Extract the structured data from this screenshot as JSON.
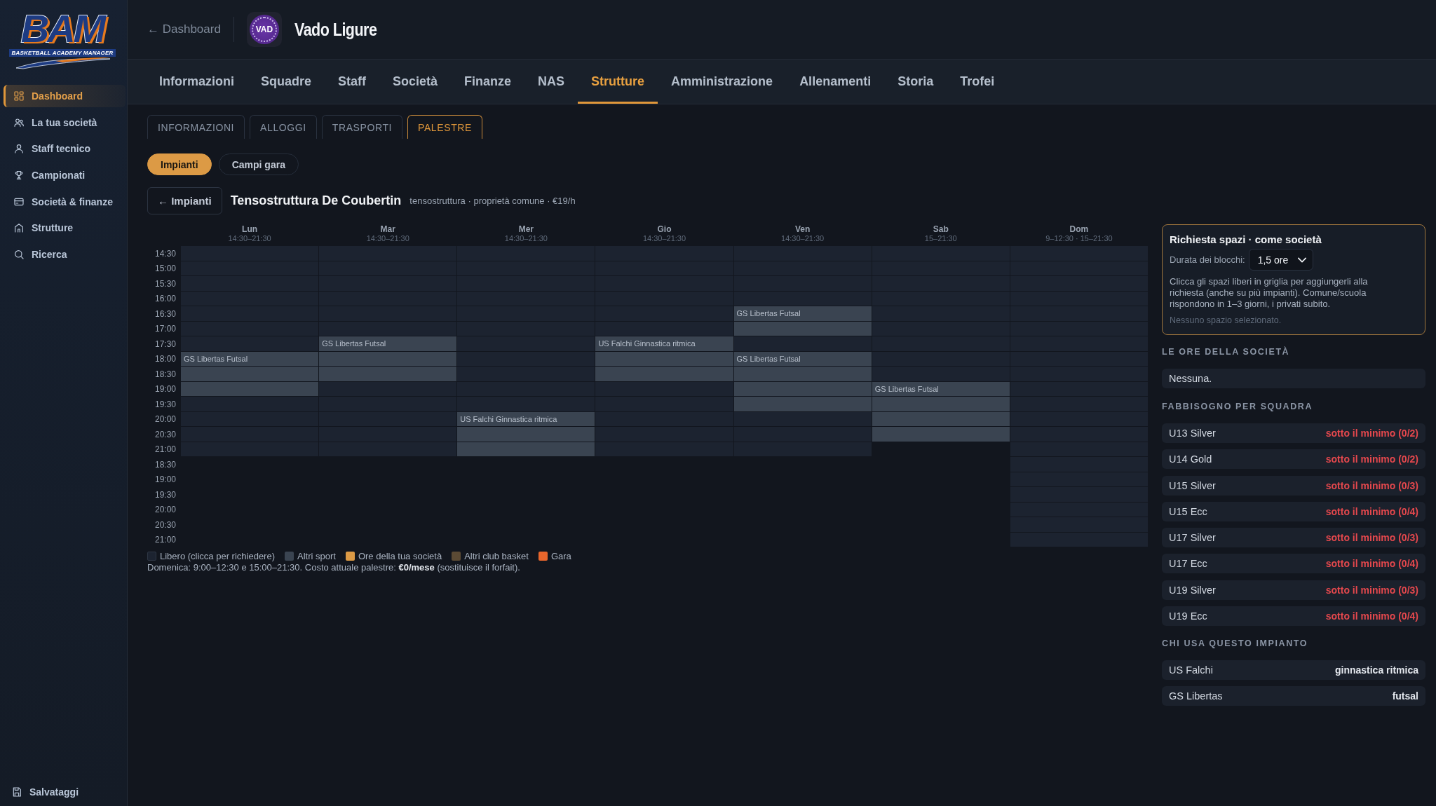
{
  "sidebar": {
    "logo": {
      "wordmark": "BAM",
      "tagline": "BASKETBALL ACADEMY MANAGER"
    },
    "items": [
      {
        "label": "Dashboard",
        "selected": true
      },
      {
        "label": "La tua società",
        "selected": false
      },
      {
        "label": "Staff tecnico",
        "selected": false
      },
      {
        "label": "Campionati",
        "selected": false
      },
      {
        "label": "Società & finanze",
        "selected": false
      },
      {
        "label": "Strutture",
        "selected": false
      },
      {
        "label": "Ricerca",
        "selected": false
      }
    ],
    "footer_item": "Salvataggi"
  },
  "header": {
    "back_link": "← Dashboard",
    "club": {
      "badge": "VAD",
      "name": "Vado Ligure"
    }
  },
  "main_tabs": [
    {
      "label": "Informazioni",
      "selected": false
    },
    {
      "label": "Squadre",
      "selected": false
    },
    {
      "label": "Staff",
      "selected": false
    },
    {
      "label": "Società",
      "selected": false
    },
    {
      "label": "Finanze",
      "selected": false
    },
    {
      "label": "NAS",
      "selected": false
    },
    {
      "label": "Strutture",
      "selected": true
    },
    {
      "label": "Amministrazione",
      "selected": false
    },
    {
      "label": "Allenamenti",
      "selected": false
    },
    {
      "label": "Storia",
      "selected": false
    },
    {
      "label": "Trofei",
      "selected": false
    }
  ],
  "sub_tabs": [
    {
      "label": "INFORMAZIONI",
      "selected": false
    },
    {
      "label": "ALLOGGI",
      "selected": false
    },
    {
      "label": "TRASPORTI",
      "selected": false
    },
    {
      "label": "PALESTRE",
      "selected": true
    }
  ],
  "view_tabs": [
    {
      "label": "Impianti",
      "selected": true
    },
    {
      "label": "Campi gara",
      "selected": false
    }
  ],
  "facility": {
    "back_button": "← Impianti",
    "title": "Tensostruttura De Coubertin",
    "details": "tensostruttura · proprietà comune · €19/h"
  },
  "schedule": {
    "times": [
      "14:30",
      "15:00",
      "15:30",
      "16:00",
      "16:30",
      "17:00",
      "17:30",
      "18:00",
      "18:30",
      "19:00",
      "19:30",
      "20:00",
      "20:30",
      "21:00",
      "18:30",
      "19:00",
      "19:30",
      "20:00",
      "20:30",
      "21:00"
    ],
    "days": [
      {
        "name": "Lun",
        "hours": "14:30–21:30",
        "slots": [
          {
            "kind": "free"
          },
          {
            "kind": "free"
          },
          {
            "kind": "free"
          },
          {
            "kind": "free"
          },
          {
            "kind": "free"
          },
          {
            "kind": "free"
          },
          {
            "kind": "free"
          },
          {
            "kind": "other_sport",
            "label": "GS Libertas Futsal"
          },
          {
            "kind": "other_sport"
          },
          {
            "kind": "other_sport"
          },
          {
            "kind": "free"
          },
          {
            "kind": "free"
          },
          {
            "kind": "free"
          },
          {
            "kind": "free"
          }
        ]
      },
      {
        "name": "Mar",
        "hours": "14:30–21:30",
        "slots": [
          {
            "kind": "free"
          },
          {
            "kind": "free"
          },
          {
            "kind": "free"
          },
          {
            "kind": "free"
          },
          {
            "kind": "free"
          },
          {
            "kind": "free"
          },
          {
            "kind": "other_sport",
            "label": "GS Libertas Futsal"
          },
          {
            "kind": "other_sport"
          },
          {
            "kind": "other_sport"
          },
          {
            "kind": "free"
          },
          {
            "kind": "free"
          },
          {
            "kind": "free"
          },
          {
            "kind": "free"
          },
          {
            "kind": "free"
          }
        ]
      },
      {
        "name": "Mer",
        "hours": "14:30–21:30",
        "slots": [
          {
            "kind": "free"
          },
          {
            "kind": "free"
          },
          {
            "kind": "free"
          },
          {
            "kind": "free"
          },
          {
            "kind": "free"
          },
          {
            "kind": "free"
          },
          {
            "kind": "free"
          },
          {
            "kind": "free"
          },
          {
            "kind": "free"
          },
          {
            "kind": "free"
          },
          {
            "kind": "free"
          },
          {
            "kind": "other_sport",
            "label": "US Falchi Ginnastica ritmica"
          },
          {
            "kind": "other_sport"
          },
          {
            "kind": "other_sport"
          }
        ]
      },
      {
        "name": "Gio",
        "hours": "14:30–21:30",
        "slots": [
          {
            "kind": "free"
          },
          {
            "kind": "free"
          },
          {
            "kind": "free"
          },
          {
            "kind": "free"
          },
          {
            "kind": "free"
          },
          {
            "kind": "free"
          },
          {
            "kind": "other_sport",
            "label": "US Falchi Ginnastica ritmica"
          },
          {
            "kind": "other_sport"
          },
          {
            "kind": "other_sport"
          },
          {
            "kind": "free"
          },
          {
            "kind": "free"
          },
          {
            "kind": "free"
          },
          {
            "kind": "free"
          },
          {
            "kind": "free"
          }
        ]
      },
      {
        "name": "Ven",
        "hours": "14:30–21:30",
        "slots": [
          {
            "kind": "free"
          },
          {
            "kind": "free"
          },
          {
            "kind": "free"
          },
          {
            "kind": "free"
          },
          {
            "kind": "other_sport",
            "label": "GS Libertas Futsal"
          },
          {
            "kind": "other_sport"
          },
          {
            "kind": "free"
          },
          {
            "kind": "other_sport",
            "label": "GS Libertas Futsal"
          },
          {
            "kind": "other_sport"
          },
          {
            "kind": "other_sport"
          },
          {
            "kind": "other_sport"
          },
          {
            "kind": "free"
          },
          {
            "kind": "free"
          },
          {
            "kind": "free"
          }
        ]
      },
      {
        "name": "Sab",
        "hours": "15–21:30",
        "slots": [
          {
            "kind": "free"
          },
          {
            "kind": "free"
          },
          {
            "kind": "free"
          },
          {
            "kind": "free"
          },
          {
            "kind": "free"
          },
          {
            "kind": "free"
          },
          {
            "kind": "free"
          },
          {
            "kind": "free"
          },
          {
            "kind": "free"
          },
          {
            "kind": "other_sport",
            "label": "GS Libertas Futsal"
          },
          {
            "kind": "other_sport"
          },
          {
            "kind": "other_sport"
          },
          {
            "kind": "other_sport"
          }
        ]
      },
      {
        "name": "Dom",
        "hours": "9–12:30 · 15–21:30",
        "slots": [
          {
            "kind": "free"
          },
          {
            "kind": "free"
          },
          {
            "kind": "free"
          },
          {
            "kind": "free"
          },
          {
            "kind": "free"
          },
          {
            "kind": "free"
          },
          {
            "kind": "free"
          },
          {
            "kind": "free"
          },
          {
            "kind": "free"
          },
          {
            "kind": "free"
          },
          {
            "kind": "free"
          },
          {
            "kind": "free"
          },
          {
            "kind": "free"
          },
          {
            "kind": "free"
          },
          {
            "kind": "free"
          },
          {
            "kind": "free"
          },
          {
            "kind": "free"
          },
          {
            "kind": "free"
          },
          {
            "kind": "free"
          },
          {
            "kind": "free"
          }
        ]
      }
    ]
  },
  "legend": [
    {
      "label": "Libero (clicca per richiedere)",
      "color": "#1c2330"
    },
    {
      "label": "Altri sport",
      "color": "#3a4451"
    },
    {
      "label": "Ore della tua società",
      "color": "#dc9a45"
    },
    {
      "label": "Altri club basket",
      "color": "#5b4a34"
    },
    {
      "label": "Gara",
      "color": "#e8662c"
    }
  ],
  "note": "Domenica: 9:00–12:30 e 15:00–21:30. Costo attuale palestre: **€0/mese** (sostituisce il forfait).",
  "request_panel": {
    "title": "Richiesta spazi · come società",
    "duration_label": "Durata dei blocchi:",
    "duration_value": "1,5 ore",
    "help": "Clicca gli spazi liberi in griglia per aggiungerli alla richiesta (anche su più impianti). Comune/scuola rispondono in 1–3 giorni, i privati subito.",
    "status": "Nessuno spazio selezionato."
  },
  "club_hours": {
    "title": "LE ORE DELLA SOCIETÀ",
    "items": [
      "Nessuna."
    ]
  },
  "team_needs": {
    "title": "FABBISOGNO PER SQUADRA",
    "rows": [
      {
        "team": "U13 Silver",
        "status": "sotto il minimo (0/2)"
      },
      {
        "team": "U14 Gold",
        "status": "sotto il minimo (0/2)"
      },
      {
        "team": "U15 Silver",
        "status": "sotto il minimo (0/3)"
      },
      {
        "team": "U15 Ecc",
        "status": "sotto il minimo (0/4)"
      },
      {
        "team": "U17 Silver",
        "status": "sotto il minimo (0/3)"
      },
      {
        "team": "U17 Ecc",
        "status": "sotto il minimo (0/4)"
      },
      {
        "team": "U19 Silver",
        "status": "sotto il minimo (0/3)"
      },
      {
        "team": "U19 Ecc",
        "status": "sotto il minimo (0/4)"
      }
    ]
  },
  "facility_users": {
    "title": "CHI USA QUESTO IMPIANTO",
    "rows": [
      {
        "club": "US Falchi",
        "sport": "ginnastica ritmica"
      },
      {
        "club": "GS Libertas",
        "sport": "futsal"
      }
    ]
  }
}
